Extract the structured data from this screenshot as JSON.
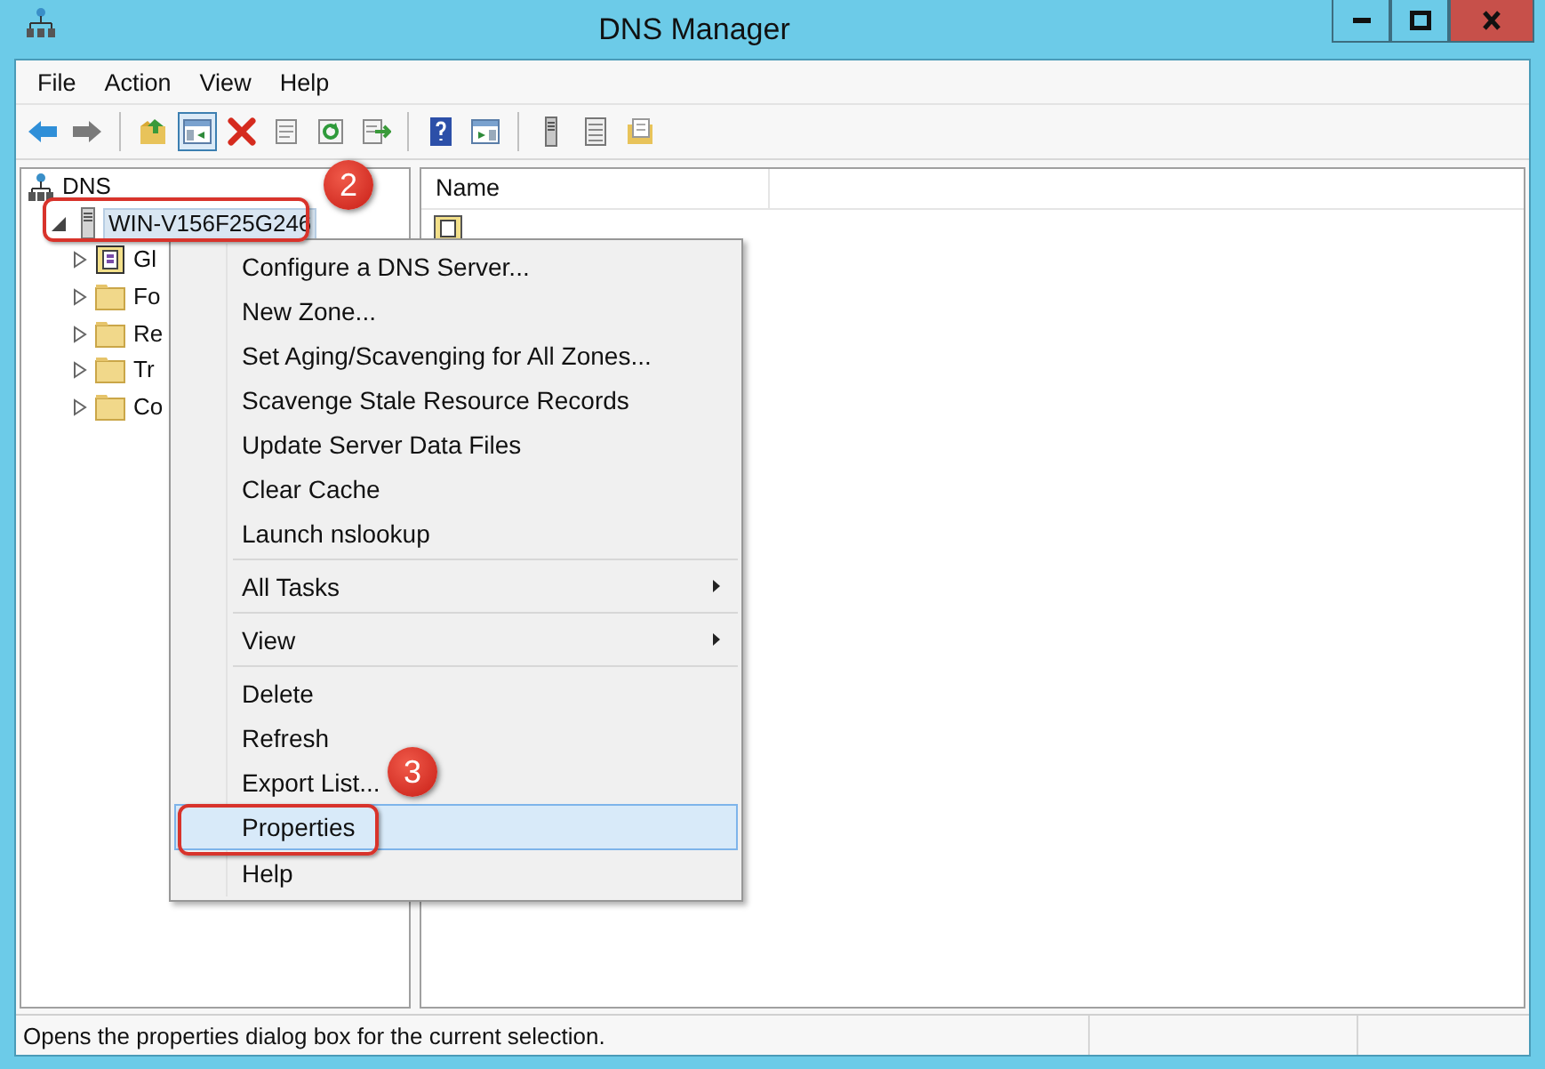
{
  "window": {
    "title": "DNS Manager"
  },
  "menu_bar": [
    "File",
    "Action",
    "View",
    "Help"
  ],
  "toolbar": [
    {
      "kind": "back",
      "pressed": false
    },
    {
      "kind": "forward",
      "pressed": false
    },
    {
      "kind": "separator"
    },
    {
      "kind": "up",
      "pressed": false
    },
    {
      "kind": "tree",
      "pressed": true
    },
    {
      "kind": "delete",
      "pressed": false
    },
    {
      "kind": "properties",
      "pressed": false
    },
    {
      "kind": "refresh",
      "pressed": false
    },
    {
      "kind": "export",
      "pressed": false
    },
    {
      "kind": "separator"
    },
    {
      "kind": "help",
      "pressed": false
    },
    {
      "kind": "pane",
      "pressed": false
    },
    {
      "kind": "separator"
    },
    {
      "kind": "server",
      "pressed": false
    },
    {
      "kind": "list",
      "pressed": false
    },
    {
      "kind": "note",
      "pressed": false
    }
  ],
  "tree": {
    "label": "DNS",
    "kind": "root",
    "children": [
      {
        "label": "WIN-V156F25G246",
        "kind": "server",
        "expanded": true,
        "selected": true,
        "children": [
          {
            "label": "Gl",
            "kind": "logs",
            "expanded": false,
            "selected": false
          },
          {
            "label": "Fo",
            "kind": "folder",
            "expanded": false,
            "selected": false
          },
          {
            "label": "Re",
            "kind": "folder",
            "expanded": false,
            "selected": false
          },
          {
            "label": "Tr",
            "kind": "folder",
            "expanded": false,
            "selected": false
          },
          {
            "label": "Co",
            "kind": "folder",
            "expanded": false,
            "selected": false
          }
        ]
      }
    ]
  },
  "list": {
    "columns": [
      "Name"
    ]
  },
  "context_menu": [
    {
      "kind": "item",
      "label": "Configure a DNS Server...",
      "selected": false
    },
    {
      "kind": "item",
      "label": "New Zone...",
      "selected": false
    },
    {
      "kind": "item",
      "label": "Set Aging/Scavenging for All Zones...",
      "selected": false
    },
    {
      "kind": "item",
      "label": "Scavenge Stale Resource Records",
      "selected": false
    },
    {
      "kind": "item",
      "label": "Update Server Data Files",
      "selected": false
    },
    {
      "kind": "item",
      "label": "Clear Cache",
      "selected": false
    },
    {
      "kind": "item",
      "label": "Launch nslookup",
      "selected": false
    },
    {
      "kind": "separator"
    },
    {
      "kind": "submenu",
      "label": "All Tasks",
      "selected": false
    },
    {
      "kind": "separator"
    },
    {
      "kind": "submenu",
      "label": "View",
      "selected": false
    },
    {
      "kind": "separator"
    },
    {
      "kind": "item",
      "label": "Delete",
      "selected": false
    },
    {
      "kind": "item",
      "label": "Refresh",
      "selected": false
    },
    {
      "kind": "item",
      "label": "Export List...",
      "selected": false
    },
    {
      "kind": "item",
      "label": "Properties",
      "selected": true
    },
    {
      "kind": "item",
      "label": "Help",
      "selected": false
    }
  ],
  "callouts": [
    "2",
    "3"
  ],
  "status_bar": {
    "text": "Opens the properties dialog box for the current selection."
  }
}
